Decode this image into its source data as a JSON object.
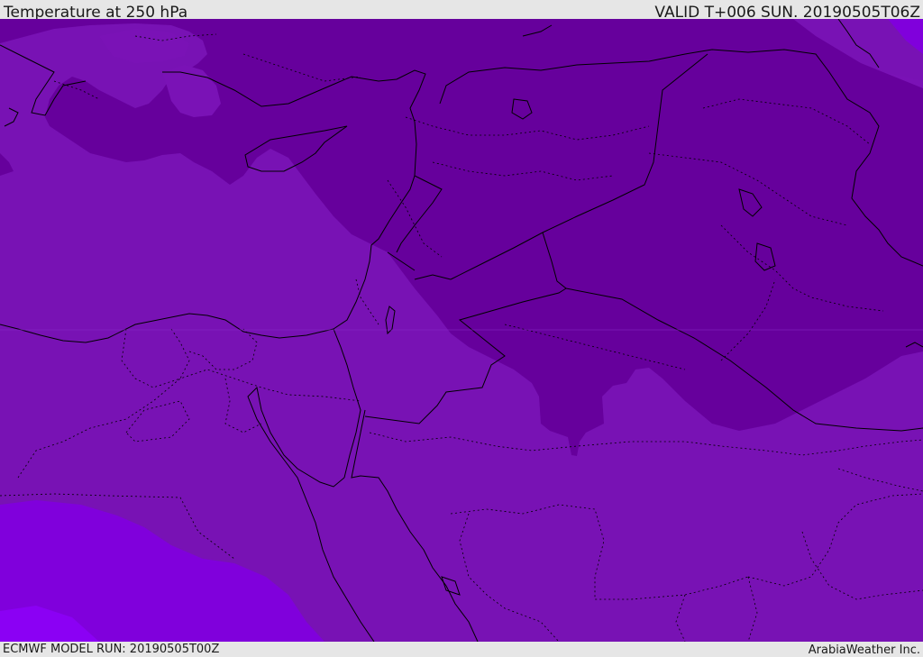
{
  "header": {
    "title": "Temperature at 250 hPa",
    "valid_time": "VALID T+006 SUN. 20190505T06Z"
  },
  "footer": {
    "model_run": "ECMWF MODEL RUN: 20190505T00Z",
    "credit": "ArabiaWeather Inc."
  },
  "map": {
    "region": "Eastern Mediterranean / Middle East",
    "field": "temperature at 250 hPa",
    "colors": {
      "coldest_band": "#650099",
      "cold_band": "#7212af",
      "mid_band": "#7810b9",
      "warm_band": "#8000db",
      "warmest_band": "#8c00f4",
      "coastline": "#000000",
      "border": "#000000"
    },
    "legend": "none"
  }
}
